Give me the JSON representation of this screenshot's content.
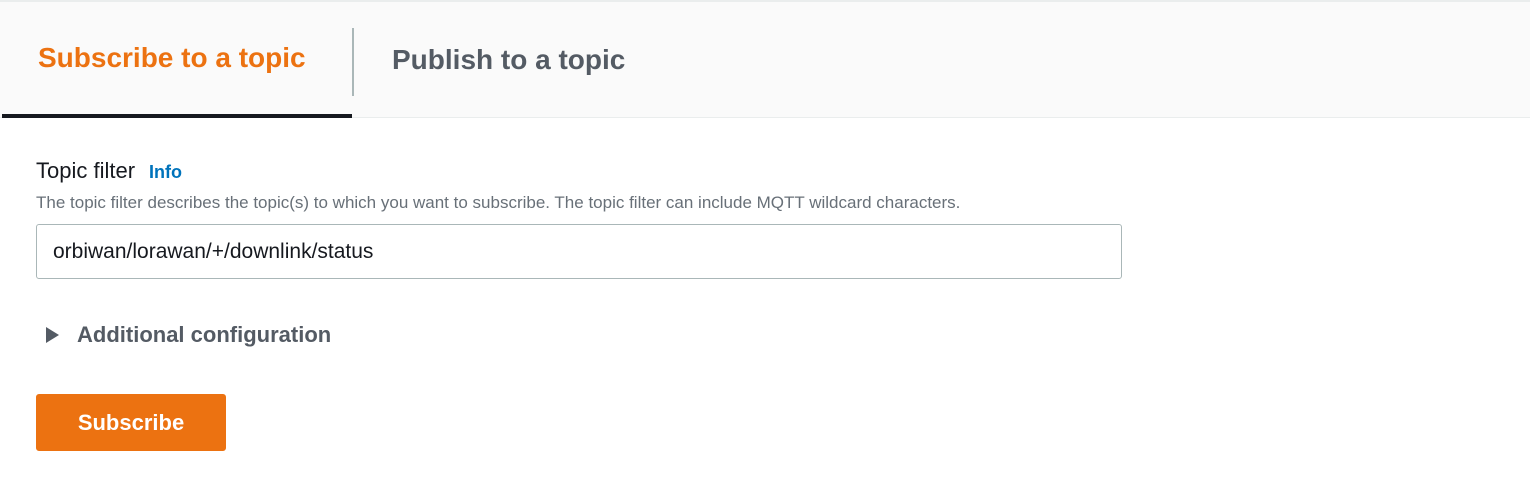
{
  "tabs": {
    "subscribe_label": "Subscribe to a topic",
    "publish_label": "Publish to a topic",
    "active": "subscribe"
  },
  "topic_filter": {
    "label": "Topic filter",
    "info_link": "Info",
    "description": "The topic filter describes the topic(s) to which you want to subscribe. The topic filter can include MQTT wildcard characters.",
    "value": "orbiwan/lorawan/+/downlink/status"
  },
  "additional_configuration": {
    "label": "Additional configuration",
    "expanded": false,
    "icon": "caret-right-icon"
  },
  "actions": {
    "subscribe_label": "Subscribe"
  },
  "colors": {
    "accent": "#ec7211",
    "link": "#0073bb",
    "text": "#16191f",
    "muted": "#687078"
  }
}
